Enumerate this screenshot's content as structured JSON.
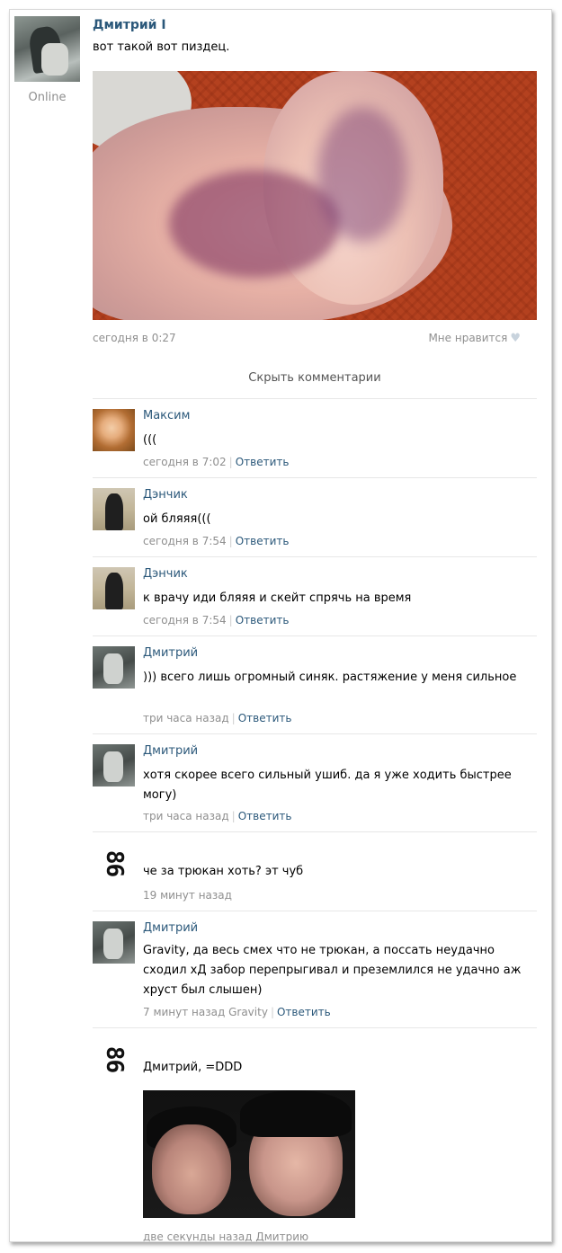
{
  "post": {
    "author": "Дмитрий I",
    "status": "Online",
    "text": "вот такой вот пиздец.",
    "date": "сегодня в 0:27",
    "like_label": "Мне нравится",
    "like_icon": "heart-icon"
  },
  "hide_comments_label": "Скрыть комментарии",
  "comments": [
    {
      "name": "Максим",
      "text": "(((",
      "time": "сегодня в 7:02",
      "reply": "Ответить"
    },
    {
      "name": "Дэнчик",
      "text": "ой бляяя(((",
      "time": "сегодня в 7:54",
      "reply": "Ответить"
    },
    {
      "name": "Дэнчик",
      "text": "к врачу иди бляяя и скейт спрячь на время",
      "time": "сегодня в 7:54",
      "reply": "Ответить"
    },
    {
      "name": "Дмитрий",
      "text": "))) всего лишь огромный синяк. растяжение у меня сильное",
      "time": "три часа назад",
      "reply": "Ответить"
    },
    {
      "name": "Дмитрий",
      "text": "хотя скорее всего сильный ушиб. да я уже ходить быстрее могу)",
      "time": "три часа назад",
      "reply": "Ответить"
    },
    {
      "name": "",
      "avatar_text": "86",
      "text": "че за трюкан хоть? эт чуб",
      "time": "19 минут назад"
    },
    {
      "name": "Дмитрий",
      "text": "Gravity, да весь смех что не трюкан, а поссать неудачно сходил хД забор перепрыгивал и преземлился не удачно аж хруст был слышен)",
      "time": "7 минут назад Gravity",
      "reply": "Ответить"
    },
    {
      "name": "",
      "avatar_text": "86",
      "text": "Дмитрий, =DDD",
      "time": "две секунды назад Дмитрию"
    }
  ]
}
